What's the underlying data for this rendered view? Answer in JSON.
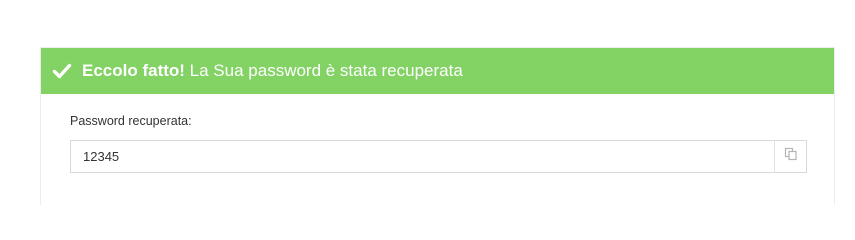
{
  "banner": {
    "strong_text": "Eccolo fatto!",
    "message": " La Sua password è stata recuperata",
    "icon": "check-icon",
    "background_color": "#82d264"
  },
  "form": {
    "label": "Password recuperata:",
    "value": "12345",
    "copy_icon": "copy-icon"
  }
}
